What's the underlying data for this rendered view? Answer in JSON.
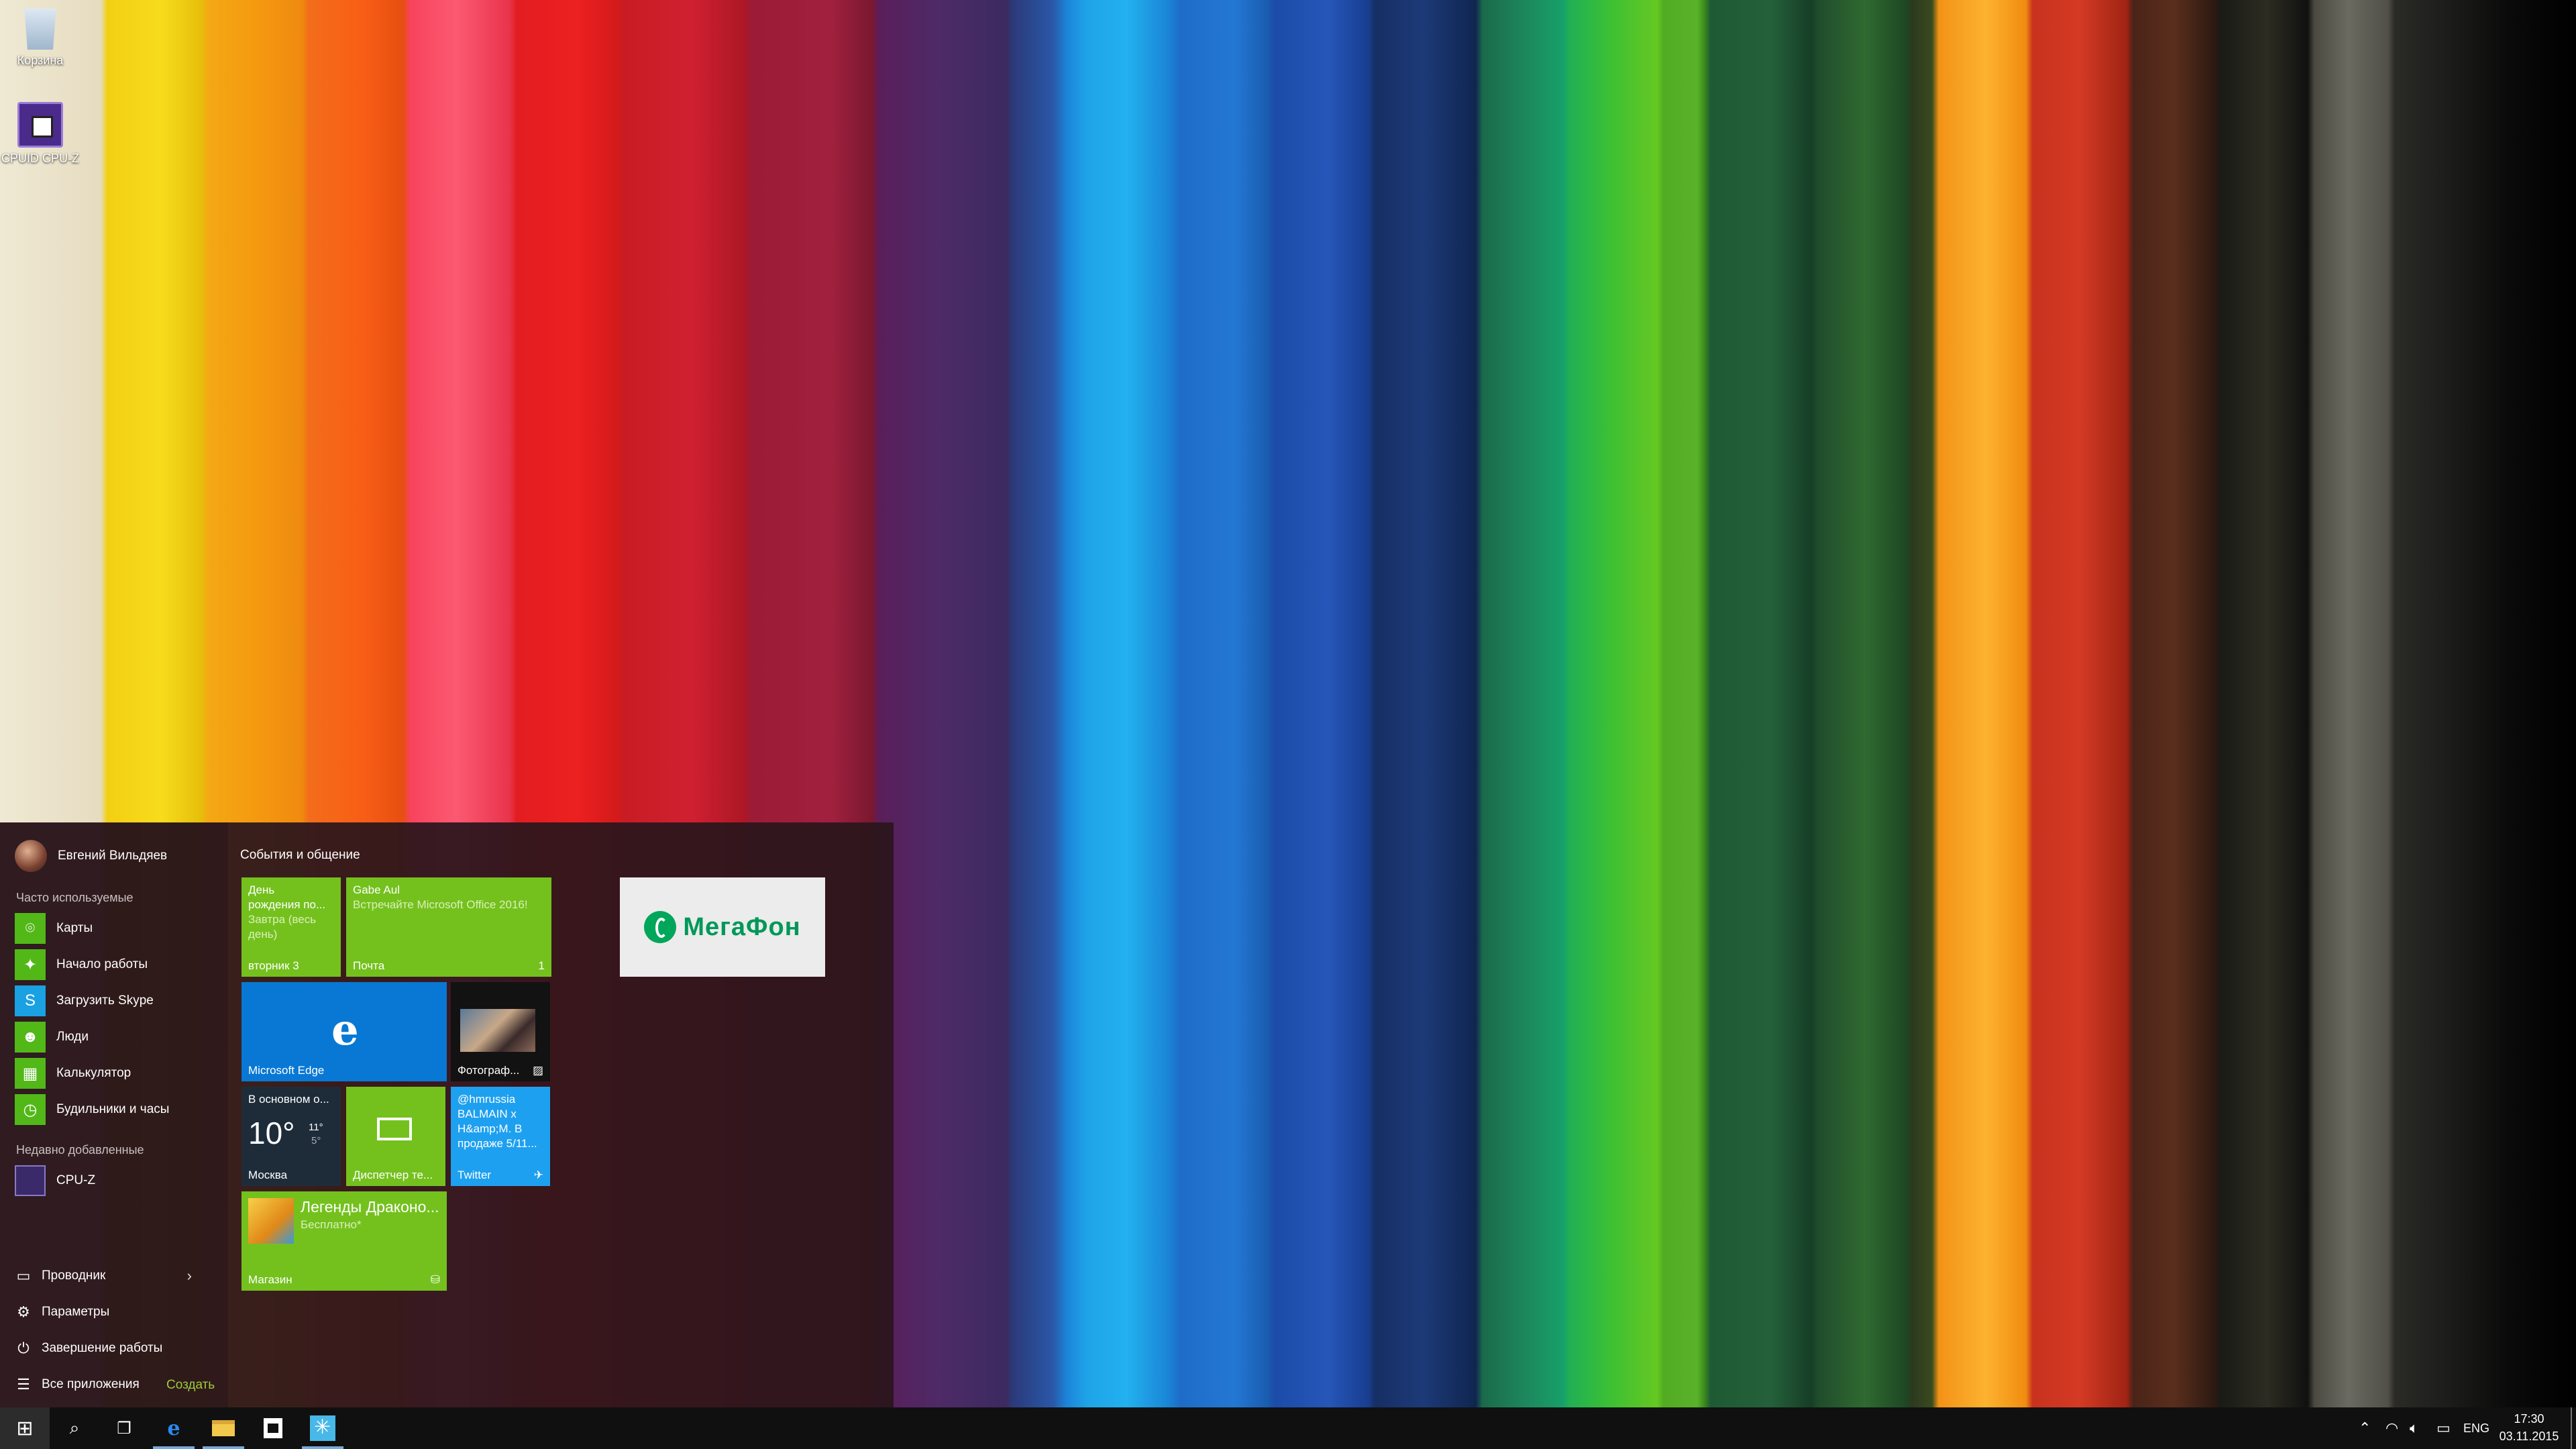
{
  "desktop": {
    "icons": [
      {
        "label": "Корзина",
        "icon": "recycle-bin-icon"
      },
      {
        "label": "CPUID CPU-Z",
        "icon": "cpuz-icon"
      }
    ]
  },
  "start_menu": {
    "user_name": "Евгений Вильдяев",
    "most_used_label": "Часто используемые",
    "most_used": [
      {
        "label": "Карты",
        "icon": "maps-icon"
      },
      {
        "label": "Начало работы",
        "icon": "get-started-icon"
      },
      {
        "label": "Загрузить Skype",
        "icon": "skype-icon"
      },
      {
        "label": "Люди",
        "icon": "people-icon"
      },
      {
        "label": "Калькулятор",
        "icon": "calculator-icon"
      },
      {
        "label": "Будильники и часы",
        "icon": "alarm-clock-icon"
      }
    ],
    "recent_label": "Недавно добавленные",
    "recent": [
      {
        "label": "CPU-Z",
        "icon": "cpuz-icon"
      }
    ],
    "system": {
      "explorer": "Проводник",
      "settings": "Параметры",
      "shutdown": "Завершение работы",
      "all_apps": "Все приложения",
      "create": "Создать"
    },
    "group_title": "События и общение",
    "tiles": {
      "calendar": {
        "line1": "День",
        "line2": "рождения по...",
        "line3": "Завтра (весь",
        "line4": "день)",
        "footer": "вторник 3"
      },
      "mail": {
        "sender": "Gabe Aul",
        "subject": "Встречайте Microsoft Office 2016!",
        "footer": "Почта",
        "count": "1"
      },
      "edge": {
        "label": "Microsoft Edge"
      },
      "photos": {
        "label": "Фотограф..."
      },
      "weather": {
        "caption": "В основном о...",
        "temp": "10°",
        "high": "11°",
        "low": "5°",
        "city": "Москва"
      },
      "device": {
        "label": "Диспетчер те..."
      },
      "twitter": {
        "text": "@hmrussia BALMAIN x H&amp;M. В продаже 5/11...",
        "label": "Twitter"
      },
      "store": {
        "title": "Легенды Драконо...",
        "subtitle": "Бесплатно*",
        "label": "Магазин"
      },
      "megafon": {
        "label": "МегаФон"
      }
    }
  },
  "taskbar": {
    "language": "ENG",
    "time": "17:30",
    "date": "03.11.2015"
  },
  "colors": {
    "tile_green": "#74c11e",
    "tile_blue": "#0878d4",
    "start_bg": "#2a161c",
    "megafon_green": "#00a65a"
  }
}
